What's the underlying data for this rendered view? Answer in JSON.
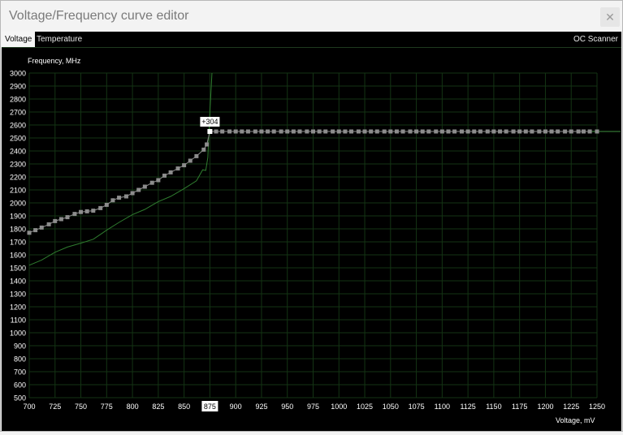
{
  "window": {
    "title": "Voltage/Frequency curve editor",
    "close_label": "✕"
  },
  "tabs": [
    {
      "label": "Voltage"
    },
    {
      "label": "Temperature"
    }
  ],
  "oc_scanner_label": "OC Scanner",
  "chart_data": {
    "type": "line",
    "xlabel": "Voltage, mV",
    "ylabel": "Frequency, MHz",
    "xlim": [
      700,
      1250
    ],
    "ylim": [
      500,
      3000
    ],
    "x_ticks": [
      700,
      725,
      750,
      775,
      800,
      825,
      850,
      875,
      900,
      925,
      950,
      975,
      1000,
      1025,
      1050,
      1075,
      1100,
      1125,
      1150,
      1175,
      1200,
      1225,
      1250
    ],
    "y_ticks": [
      500,
      600,
      700,
      800,
      900,
      1000,
      1100,
      1200,
      1300,
      1400,
      1500,
      1600,
      1700,
      1800,
      1900,
      2000,
      2100,
      2200,
      2300,
      2400,
      2500,
      2600,
      2700,
      2800,
      2900,
      3000
    ],
    "grid": true,
    "selected_point": {
      "x_label": "875",
      "y_label": "2550",
      "offset_label": "+304"
    },
    "series": [
      {
        "values": [
          [
            700,
            1770
          ],
          [
            706,
            1790
          ],
          [
            712,
            1810
          ],
          [
            719,
            1835
          ],
          [
            725,
            1860
          ],
          [
            731,
            1875
          ],
          [
            737,
            1890
          ],
          [
            744,
            1915
          ],
          [
            750,
            1930
          ],
          [
            756,
            1935
          ],
          [
            762,
            1940
          ],
          [
            769,
            1960
          ],
          [
            775,
            1985
          ],
          [
            781,
            2020
          ],
          [
            787,
            2040
          ],
          [
            794,
            2050
          ],
          [
            800,
            2075
          ],
          [
            806,
            2100
          ],
          [
            812,
            2125
          ],
          [
            819,
            2155
          ],
          [
            825,
            2175
          ],
          [
            831,
            2210
          ],
          [
            837,
            2235
          ],
          [
            844,
            2265
          ],
          [
            850,
            2290
          ],
          [
            856,
            2325
          ],
          [
            862,
            2360
          ],
          [
            869,
            2410
          ],
          [
            872,
            2450
          ],
          [
            875,
            2550
          ],
          [
            881,
            2550
          ],
          [
            887,
            2550
          ],
          [
            894,
            2550
          ],
          [
            900,
            2550
          ],
          [
            906,
            2550
          ],
          [
            912,
            2550
          ],
          [
            919,
            2550
          ],
          [
            925,
            2550
          ],
          [
            931,
            2550
          ],
          [
            937,
            2550
          ],
          [
            944,
            2550
          ],
          [
            950,
            2550
          ],
          [
            956,
            2550
          ],
          [
            962,
            2550
          ],
          [
            969,
            2550
          ],
          [
            975,
            2550
          ],
          [
            981,
            2550
          ],
          [
            987,
            2550
          ],
          [
            994,
            2550
          ],
          [
            1000,
            2550
          ],
          [
            1006,
            2550
          ],
          [
            1012,
            2550
          ],
          [
            1019,
            2550
          ],
          [
            1025,
            2550
          ],
          [
            1031,
            2550
          ],
          [
            1037,
            2550
          ],
          [
            1044,
            2550
          ],
          [
            1050,
            2550
          ],
          [
            1056,
            2550
          ],
          [
            1062,
            2550
          ],
          [
            1069,
            2550
          ],
          [
            1075,
            2550
          ],
          [
            1081,
            2550
          ],
          [
            1087,
            2550
          ],
          [
            1094,
            2550
          ],
          [
            1100,
            2550
          ],
          [
            1106,
            2550
          ],
          [
            1112,
            2550
          ],
          [
            1119,
            2550
          ],
          [
            1125,
            2550
          ],
          [
            1131,
            2550
          ],
          [
            1137,
            2550
          ],
          [
            1144,
            2550
          ],
          [
            1150,
            2550
          ],
          [
            1156,
            2550
          ],
          [
            1162,
            2550
          ],
          [
            1169,
            2550
          ],
          [
            1175,
            2550
          ],
          [
            1181,
            2550
          ],
          [
            1187,
            2550
          ],
          [
            1194,
            2550
          ],
          [
            1200,
            2550
          ],
          [
            1206,
            2550
          ],
          [
            1212,
            2550
          ],
          [
            1219,
            2550
          ],
          [
            1225,
            2550
          ],
          [
            1232,
            2550
          ],
          [
            1237,
            2550
          ],
          [
            1243,
            2550
          ],
          [
            1250,
            2550
          ]
        ]
      },
      {
        "values": [
          [
            700,
            1520
          ],
          [
            712,
            1560
          ],
          [
            725,
            1620
          ],
          [
            737,
            1660
          ],
          [
            750,
            1690
          ],
          [
            762,
            1720
          ],
          [
            775,
            1790
          ],
          [
            787,
            1850
          ],
          [
            800,
            1910
          ],
          [
            812,
            1950
          ],
          [
            825,
            2010
          ],
          [
            837,
            2050
          ],
          [
            850,
            2110
          ],
          [
            862,
            2170
          ],
          [
            868,
            2255
          ],
          [
            871,
            2250
          ],
          [
            873,
            2350
          ],
          [
            875,
            2700
          ],
          [
            877,
            3000
          ]
        ]
      }
    ]
  }
}
